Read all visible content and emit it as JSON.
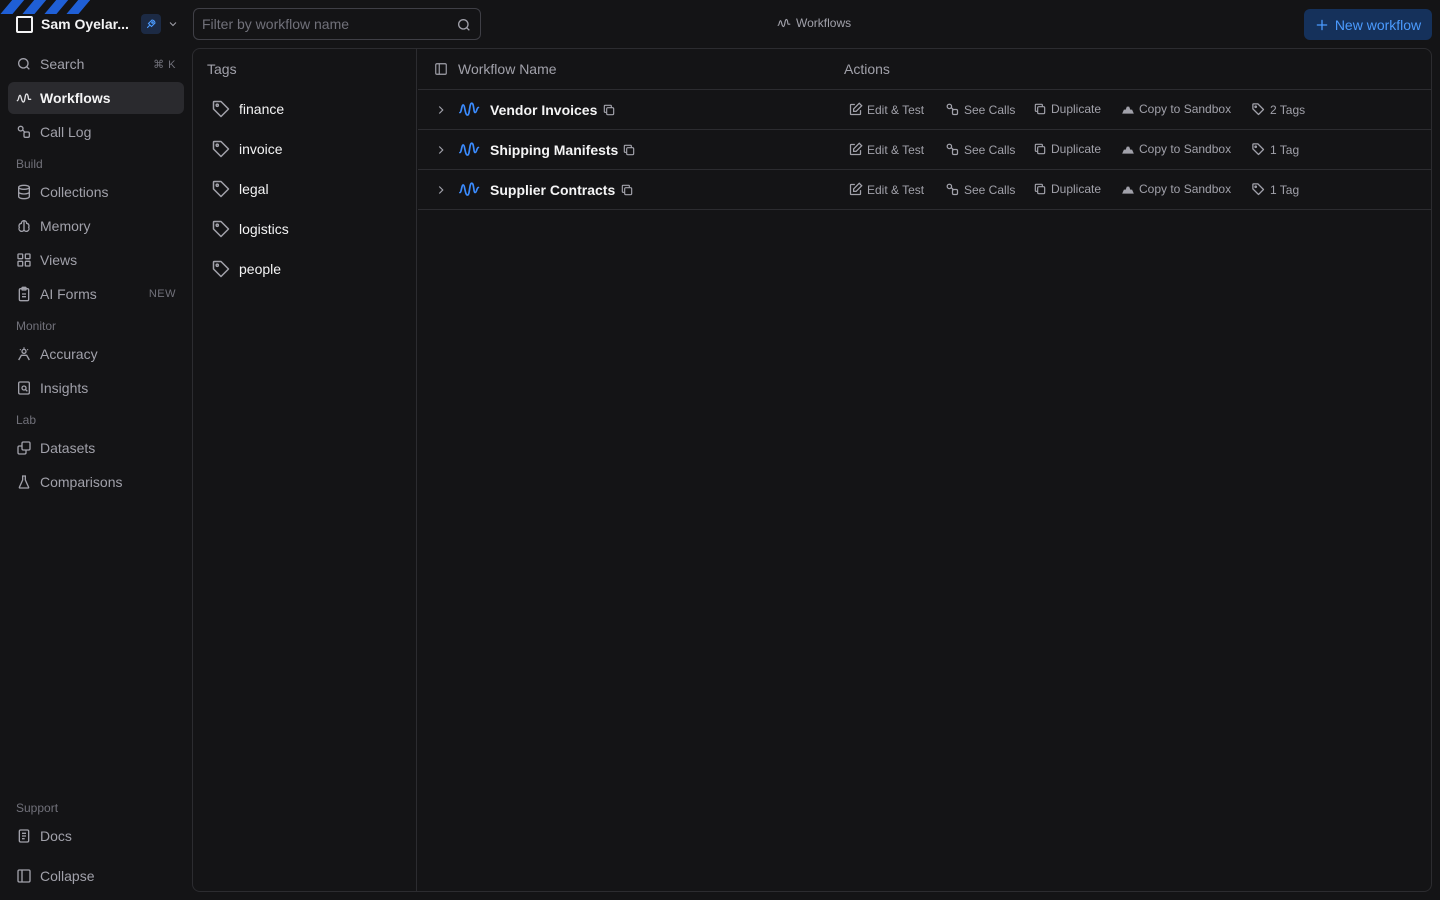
{
  "workspace": {
    "name": "Sam Oyelar..."
  },
  "nav": {
    "search": {
      "label": "Search",
      "shortcut": "⌘ K"
    },
    "workflows": {
      "label": "Workflows"
    },
    "call_log": {
      "label": "Call Log"
    },
    "build_label": "Build",
    "collections": {
      "label": "Collections"
    },
    "memory": {
      "label": "Memory"
    },
    "views": {
      "label": "Views"
    },
    "ai_forms": {
      "label": "AI Forms",
      "badge": "NEW"
    },
    "monitor_label": "Monitor",
    "accuracy": {
      "label": "Accuracy"
    },
    "insights": {
      "label": "Insights"
    },
    "lab_label": "Lab",
    "datasets": {
      "label": "Datasets"
    },
    "comparisons": {
      "label": "Comparisons"
    },
    "support_label": "Support",
    "docs": {
      "label": "Docs"
    },
    "collapse": {
      "label": "Collapse"
    }
  },
  "topbar": {
    "filter_placeholder": "Filter by workflow name",
    "title": "Workflows",
    "new_button": "New workflow"
  },
  "tags": {
    "header": "Tags",
    "items": [
      "finance",
      "invoice",
      "legal",
      "logistics",
      "people"
    ]
  },
  "table": {
    "col_name": "Workflow Name",
    "col_actions": "Actions",
    "action_labels": {
      "edit": "Edit & Test",
      "calls": "See Calls",
      "duplicate": "Duplicate",
      "sandbox": "Copy to Sandbox"
    },
    "rows": [
      {
        "name": "Vendor Invoices",
        "tags": "2 Tags"
      },
      {
        "name": "Shipping Manifests",
        "tags": "1 Tag"
      },
      {
        "name": "Supplier Contracts",
        "tags": "1 Tag"
      }
    ]
  },
  "colors": {
    "accent": "#3b8cff",
    "button_bg": "#15315b",
    "background": "#141416"
  }
}
